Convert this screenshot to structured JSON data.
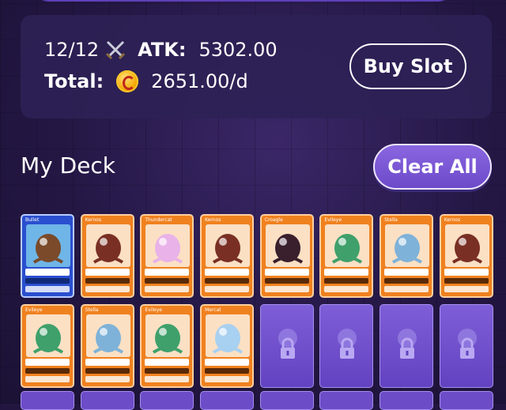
{
  "stats": {
    "slots": "12/12",
    "atk_label": "ATK:",
    "atk_value": "5302.00",
    "total_label": "Total:",
    "total_value": "2651.00/d",
    "buy_slot_label": "Buy Slot"
  },
  "deck": {
    "title": "My Deck",
    "clear_all_label": "Clear All"
  },
  "cards": [
    {
      "name": "Bullet",
      "style": "blue",
      "color": "#7a4a2a"
    },
    {
      "name": "Kernos",
      "style": "orange",
      "color": "#7a2f24"
    },
    {
      "name": "Thundercat",
      "style": "orange",
      "color": "#e9b2e8"
    },
    {
      "name": "Kernos",
      "style": "orange",
      "color": "#7a2f24"
    },
    {
      "name": "Croagle",
      "style": "orange",
      "color": "#3a1f2c"
    },
    {
      "name": "Evileye",
      "style": "orange",
      "color": "#3fa06b"
    },
    {
      "name": "Stella",
      "style": "orange",
      "color": "#7fb2d8"
    },
    {
      "name": "Kernos",
      "style": "orange",
      "color": "#7a2f24"
    },
    {
      "name": "Evileye",
      "style": "orange",
      "color": "#3fa06b"
    },
    {
      "name": "Stella",
      "style": "orange",
      "color": "#7fb2d8"
    },
    {
      "name": "Evileye",
      "style": "orange",
      "color": "#3fa06b"
    },
    {
      "name": "Mercat",
      "style": "orange",
      "color": "#a8d0f0"
    }
  ],
  "locked_slots": 4,
  "colors": {
    "accent": "#7556d1",
    "card_orange": "#f0811f",
    "card_blue": "#2a4fcf",
    "coin": "#f2a800"
  }
}
